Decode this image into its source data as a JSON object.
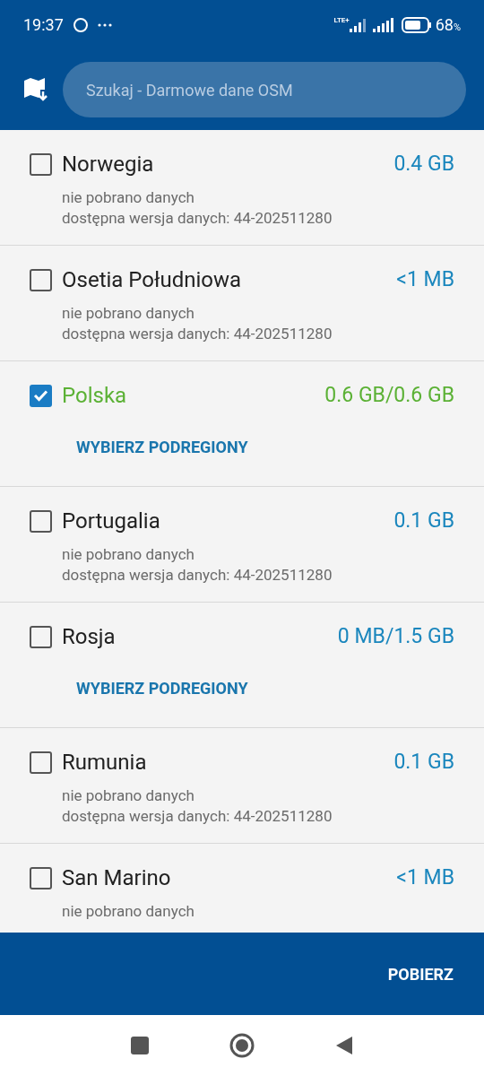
{
  "status_bar": {
    "time": "19:37",
    "battery": "68",
    "battery_unit": "%",
    "network": "LTE+"
  },
  "header": {
    "search": {
      "placeholder": "Szukaj - Darmowe dane OSM"
    }
  },
  "regions": [
    {
      "kind": "info",
      "name": "Norwegia",
      "size": "0.4 GB",
      "checked": false,
      "details": [
        "nie pobrano danych",
        "dostępna wersja danych: 44-202511280"
      ]
    },
    {
      "kind": "info",
      "name": "Osetia Południowa",
      "size": "<1 MB",
      "checked": false,
      "details": [
        "nie pobrano danych",
        "dostępna wersja danych: 44-202511280"
      ]
    },
    {
      "kind": "subregions",
      "name": "Polska",
      "size": "0.6 GB/0.6 GB",
      "checked": true,
      "action": "WYBIERZ PODREGIONY"
    },
    {
      "kind": "info",
      "name": "Portugalia",
      "size": "0.1 GB",
      "checked": false,
      "details": [
        "nie pobrano danych",
        "dostępna wersja danych: 44-202511280"
      ]
    },
    {
      "kind": "subregions",
      "name": "Rosja",
      "size": "0 MB/1.5 GB",
      "checked": false,
      "action": "WYBIERZ PODREGIONY"
    },
    {
      "kind": "info",
      "name": "Rumunia",
      "size": "0.1 GB",
      "checked": false,
      "details": [
        "nie pobrano danych",
        "dostępna wersja danych: 44-202511280"
      ]
    },
    {
      "kind": "info",
      "name": "San Marino",
      "size": "<1 MB",
      "checked": false,
      "details": [
        "nie pobrano danych"
      ]
    }
  ],
  "footer": {
    "button": "POBIERZ"
  }
}
